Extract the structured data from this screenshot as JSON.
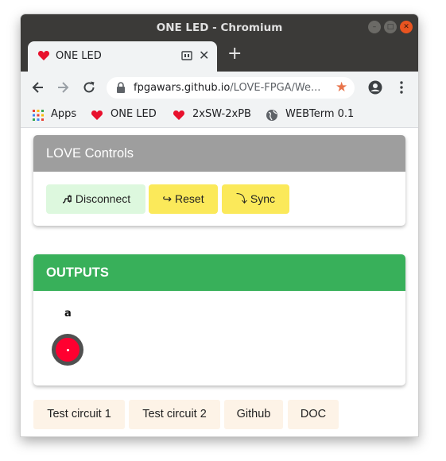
{
  "window": {
    "title": "ONE LED - Chromium"
  },
  "tab": {
    "title": "ONE LED"
  },
  "address_bar": {
    "domain": "fpgawars.github.io",
    "path": "/LOVE-FPGA/We..."
  },
  "bookmarks": [
    {
      "label": "Apps",
      "icon": "apps-grid-icon"
    },
    {
      "label": "ONE LED",
      "icon": "heart-icon"
    },
    {
      "label": "2xSW-2xPB",
      "icon": "heart-icon"
    },
    {
      "label": "WEBTerm 0.1",
      "icon": "globe-icon"
    }
  ],
  "controls": {
    "header": "LOVE Controls",
    "header_color": "#9e9e9e",
    "buttons": [
      {
        "label": "Disconnect",
        "icon": "plug-icon",
        "color": "#ddf8de"
      },
      {
        "label": "Reset",
        "icon": "arrow-right-hook-icon",
        "color": "#fbe95a"
      },
      {
        "label": "Sync",
        "icon": "arrow-curve-down-icon",
        "color": "#fbe95a"
      }
    ]
  },
  "outputs": {
    "header": "OUTPUTS",
    "header_color": "#38b05a",
    "leds": [
      {
        "label": "a",
        "color": "#ff0030"
      }
    ]
  },
  "links": [
    "Test circuit 1",
    "Test circuit 2",
    "Github",
    "DOC"
  ],
  "colors": {
    "accent_star": "#e8734a",
    "heart": "#e8112d",
    "ubuntu_close": "#e95420"
  }
}
